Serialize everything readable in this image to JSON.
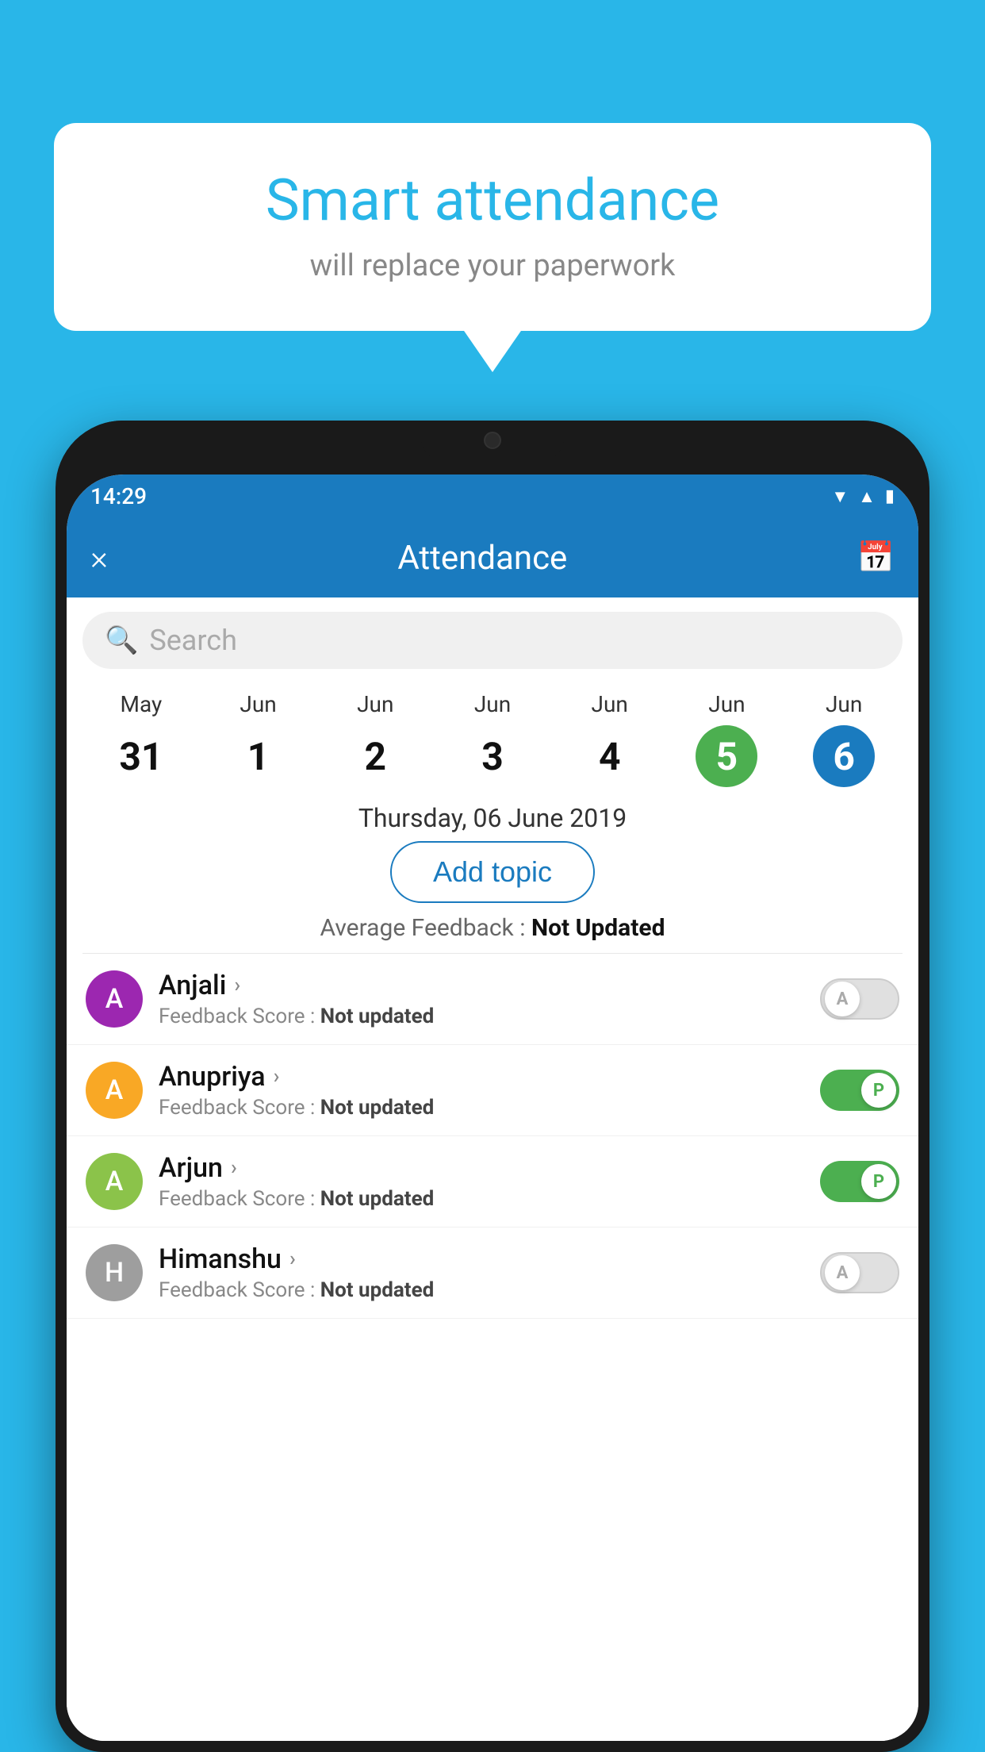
{
  "background_color": "#29b6e8",
  "speech_bubble": {
    "title": "Smart attendance",
    "subtitle": "will replace your paperwork"
  },
  "status_bar": {
    "time": "14:29",
    "icons": [
      "wifi",
      "signal",
      "battery"
    ]
  },
  "app_bar": {
    "close_label": "×",
    "title": "Attendance",
    "calendar_icon": "📅"
  },
  "search": {
    "placeholder": "Search"
  },
  "calendar": {
    "days": [
      {
        "month": "May",
        "num": "31",
        "style": "normal"
      },
      {
        "month": "Jun",
        "num": "1",
        "style": "normal"
      },
      {
        "month": "Jun",
        "num": "2",
        "style": "normal"
      },
      {
        "month": "Jun",
        "num": "3",
        "style": "normal"
      },
      {
        "month": "Jun",
        "num": "4",
        "style": "normal"
      },
      {
        "month": "Jun",
        "num": "5",
        "style": "green"
      },
      {
        "month": "Jun",
        "num": "6",
        "style": "blue"
      }
    ],
    "selected_date": "Thursday, 06 June 2019"
  },
  "add_topic_label": "Add topic",
  "avg_feedback_label": "Average Feedback :",
  "avg_feedback_value": "Not Updated",
  "students": [
    {
      "name": "Anjali",
      "avatar_letter": "A",
      "avatar_color": "#9c27b0",
      "feedback": "Feedback Score :",
      "feedback_value": "Not updated",
      "toggle": "off",
      "toggle_letter": "A"
    },
    {
      "name": "Anupriya",
      "avatar_letter": "A",
      "avatar_color": "#f9a825",
      "feedback": "Feedback Score :",
      "feedback_value": "Not updated",
      "toggle": "on",
      "toggle_letter": "P"
    },
    {
      "name": "Arjun",
      "avatar_letter": "A",
      "avatar_color": "#8bc34a",
      "feedback": "Feedback Score :",
      "feedback_value": "Not updated",
      "toggle": "on",
      "toggle_letter": "P"
    },
    {
      "name": "Himanshu",
      "avatar_letter": "H",
      "avatar_color": "#9e9e9e",
      "feedback": "Feedback Score :",
      "feedback_value": "Not updated",
      "toggle": "off",
      "toggle_letter": "A"
    }
  ]
}
